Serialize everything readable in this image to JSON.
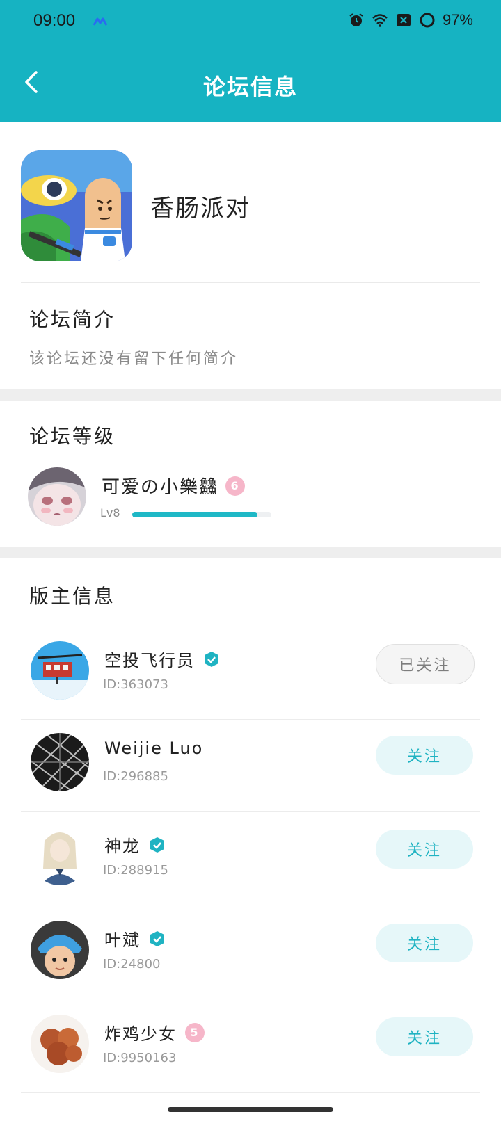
{
  "status": {
    "time": "09:00",
    "battery": "97%"
  },
  "nav": {
    "title": "论坛信息"
  },
  "forum": {
    "name": "香肠派对"
  },
  "intro": {
    "heading": "论坛简介",
    "text": "该论坛还没有留下任何简介"
  },
  "level": {
    "heading": "论坛等级",
    "user": "可爱の小樂䲜",
    "badge": "6",
    "tag": "Lv8",
    "progress": 0.9
  },
  "moderators": {
    "heading": "版主信息",
    "items": [
      {
        "name": "空投飞行员",
        "id": "ID:363073",
        "button": "已关注",
        "verified": true
      },
      {
        "name": "Weijie Luo",
        "id": "ID:296885",
        "button": "关注",
        "verified": false
      },
      {
        "name": "神龙",
        "id": "ID:288915",
        "button": "关注",
        "verified": true
      },
      {
        "name": "叶斌",
        "id": "ID:24800",
        "button": "关注",
        "verified": true
      },
      {
        "name": "炸鸡少女",
        "id": "ID:9950163",
        "button": "关注",
        "verified": false,
        "badge": "5"
      }
    ]
  },
  "colors": {
    "accent": "#16b3c2",
    "verified": "#1fb3c2",
    "pink_badge": "#f6b6c9"
  }
}
